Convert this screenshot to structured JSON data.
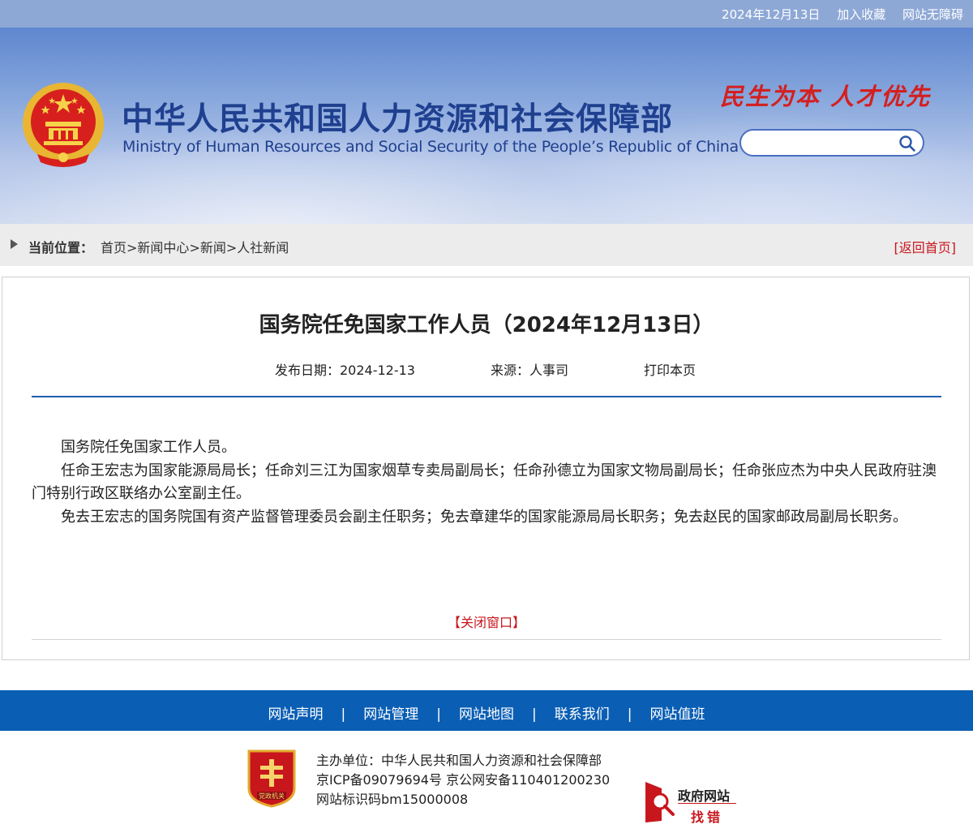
{
  "topbar": {
    "date": "2024年12月13日",
    "bookmark": "加入收藏",
    "accessibility": "网站无障碍"
  },
  "header": {
    "title_cn": "中华人民共和国人力资源和社会保障部",
    "title_en": "Ministry of Human Resources and Social Security of the People’s Republic of China",
    "slogan": "民生为本  人才优先",
    "search_placeholder": ""
  },
  "breadcrumb": {
    "label": "当前位置：",
    "items": [
      "首页",
      "新闻中心",
      "新闻",
      "人社新闻"
    ],
    "separator": ">",
    "back_home": "[返回首页]"
  },
  "article": {
    "title": "国务院任免国家工作人员（2024年12月13日）",
    "date": "发布日期：2024-12-13",
    "source": "来源：人事司",
    "print": "打印本页",
    "paragraphs": [
      "国务院任免国家工作人员。",
      "任命王宏志为国家能源局局长；任命刘三江为国家烟草专卖局副局长；任命孙德立为国家文物局副局长；任命张应杰为中央人民政府驻澳门特别行政区联络办公室副主任。",
      "免去王宏志的国务院国有资产监督管理委员会副主任职务；免去章建华的国家能源局局长职务；免去赵民的国家邮政局副局长职务。"
    ],
    "close": "【关闭窗口】"
  },
  "footer": {
    "nav": [
      "网站声明",
      "网站管理",
      "网站地图",
      "联系我们",
      "网站值班"
    ],
    "nav_separator": "|",
    "sponsor": "主办单位：中华人民共和国人力资源和社会保障部",
    "icp": "京ICP备09079694号  京公网安备110401200230",
    "site_code": "网站标识码bm15000008",
    "badge_text": "党政机关",
    "gov_logo_line1": "政府网站",
    "gov_logo_line2": "找错"
  },
  "colors": {
    "brand_blue": "#1f3f8f",
    "footer_blue": "#0a5eb4",
    "accent_red": "#c8161d"
  }
}
